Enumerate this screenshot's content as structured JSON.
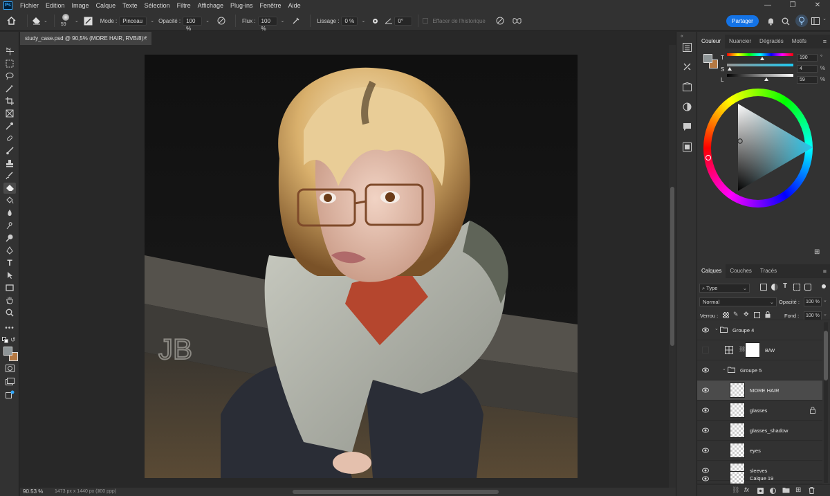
{
  "app": {
    "logo": "Ps"
  },
  "menu": [
    "Fichier",
    "Edition",
    "Image",
    "Calque",
    "Texte",
    "Sélection",
    "Filtre",
    "Affichage",
    "Plug-ins",
    "Fenêtre",
    "Aide"
  ],
  "options": {
    "brush_size": "59",
    "mode_label": "Mode :",
    "mode_value": "Pinceau",
    "opacity_label": "Opacité :",
    "opacity_value": "100 %",
    "flow_label": "Flux :",
    "flow_value": "100 %",
    "smoothing_label": "Lissage :",
    "smoothing_value": "0 %",
    "angle_value": "0°",
    "history_label": "Effacer de l'historique",
    "share_label": "Partager"
  },
  "document": {
    "tab_title": "study_case.psd @ 90,5% (MORE HAIR, RVB/8) *",
    "zoom": "90.53 %",
    "info": "1473 px x 1440 px (300 ppp)"
  },
  "color_panel": {
    "tabs": [
      "Couleur",
      "Nuancier",
      "Dégradés",
      "Motifs"
    ],
    "active_tab": 0,
    "sliders": [
      {
        "label": "T",
        "value": "190",
        "unit": "°",
        "fraction": 0.53
      },
      {
        "label": "S",
        "value": "4",
        "unit": "%",
        "fraction": 0.04
      },
      {
        "label": "L",
        "value": "59",
        "unit": "%",
        "fraction": 0.59
      }
    ],
    "foreground_color": "#8e9597",
    "background_color": "#b47842",
    "hue_color": "#1ec8f0"
  },
  "layers_panel": {
    "tabs": [
      "Calques",
      "Couches",
      "Tracés"
    ],
    "active_tab": 0,
    "filter_label": "Type",
    "blend_mode": "Normal",
    "opacity_label": "Opacité :",
    "opacity_value": "100 %",
    "lock_label": "Verrou :",
    "fill_label": "Fond :",
    "fill_value": "100 %",
    "layers": [
      {
        "name": "Groupe 4",
        "kind": "group",
        "indent": 0,
        "visible": true
      },
      {
        "name": "B/W",
        "kind": "adjustment",
        "indent": 1,
        "visible": false
      },
      {
        "name": "Groupe 5",
        "kind": "group",
        "indent": 1,
        "visible": true
      },
      {
        "name": "MORE HAIR",
        "kind": "layer",
        "indent": 2,
        "visible": true,
        "selected": true
      },
      {
        "name": "glasses",
        "kind": "layer",
        "indent": 2,
        "visible": true,
        "locked": true
      },
      {
        "name": "glasses_shadow",
        "kind": "layer",
        "indent": 2,
        "visible": true
      },
      {
        "name": "eyes",
        "kind": "layer",
        "indent": 2,
        "visible": true
      },
      {
        "name": "sleeves",
        "kind": "layer",
        "indent": 2,
        "visible": true
      },
      {
        "name": "Calque 19",
        "kind": "layer",
        "indent": 2,
        "visible": true
      }
    ]
  },
  "icons": {
    "home": "home-icon",
    "eraser": "eraser-icon",
    "search": "search-icon",
    "bell": "bell-icon",
    "eye": "eye-icon",
    "lock": "lock-icon"
  }
}
